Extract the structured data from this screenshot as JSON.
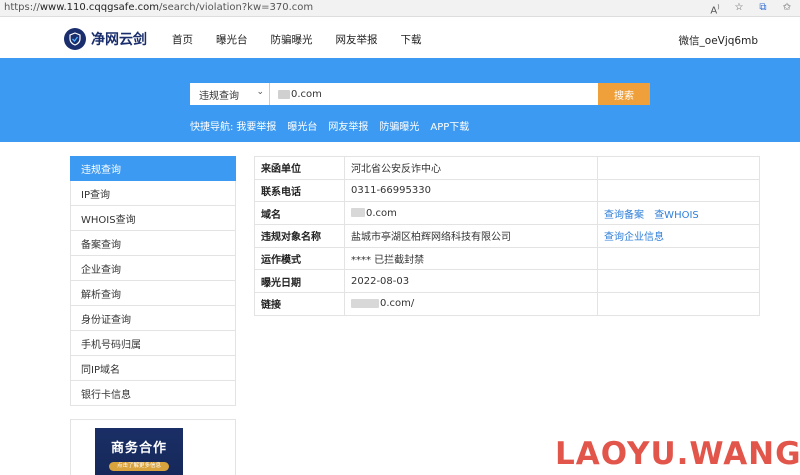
{
  "browser": {
    "url_prefix": "https://",
    "url_host": "www.110.cqqgsafe.com",
    "url_path": "/search/violation?kw=370.com",
    "icons": [
      "read-aloud-icon",
      "favorite-icon",
      "translate-icon",
      "favorites-bar-icon"
    ]
  },
  "header": {
    "logo_text": "净网云剑",
    "nav": [
      "首页",
      "曝光台",
      "防骗曝光",
      "网友举报",
      "下载"
    ],
    "wechat": "微信_oeVjq6mb"
  },
  "search": {
    "type_selected": "违规查询",
    "query_visible": "0.com",
    "button": "搜索"
  },
  "quick_nav": {
    "label": "快捷导航:",
    "links": [
      "我要举报",
      "曝光台",
      "网友举报",
      "防骗曝光",
      "APP下载"
    ]
  },
  "sidebar": {
    "items": [
      "违规查询",
      "IP查询",
      "WHOIS查询",
      "备案查询",
      "企业查询",
      "解析查询",
      "身份证查询",
      "手机号码归属",
      "同IP域名",
      "银行卡信息"
    ],
    "active_index": 0
  },
  "promo": {
    "title": "商务合作",
    "subtitle": "点击了解更多信息"
  },
  "info": {
    "rows": [
      {
        "label": "来函单位",
        "value": "河北省公安反诈中心"
      },
      {
        "label": "联系电话",
        "value": "0311-66995330"
      },
      {
        "label": "域名",
        "value": "0.com",
        "actions": [
          "查询备案",
          "查WHOIS"
        ]
      },
      {
        "label": "违规对象名称",
        "value": "盐城市亭湖区柏辉网络科技有限公司",
        "actions": [
          "查询企业信息"
        ]
      },
      {
        "label": "运作模式",
        "value": "**** 已拦截封禁"
      },
      {
        "label": "曝光日期",
        "value": "2022-08-03"
      },
      {
        "label": "链接",
        "value": "0.com/"
      }
    ]
  },
  "watermark": "LAOYU.WANG",
  "colors": {
    "banner_blue": "#3d9af2",
    "search_button": "#f0a03a",
    "link_blue": "#2f7fd8",
    "watermark_red": "#e2554a",
    "logo_navy": "#1a2e6d"
  }
}
